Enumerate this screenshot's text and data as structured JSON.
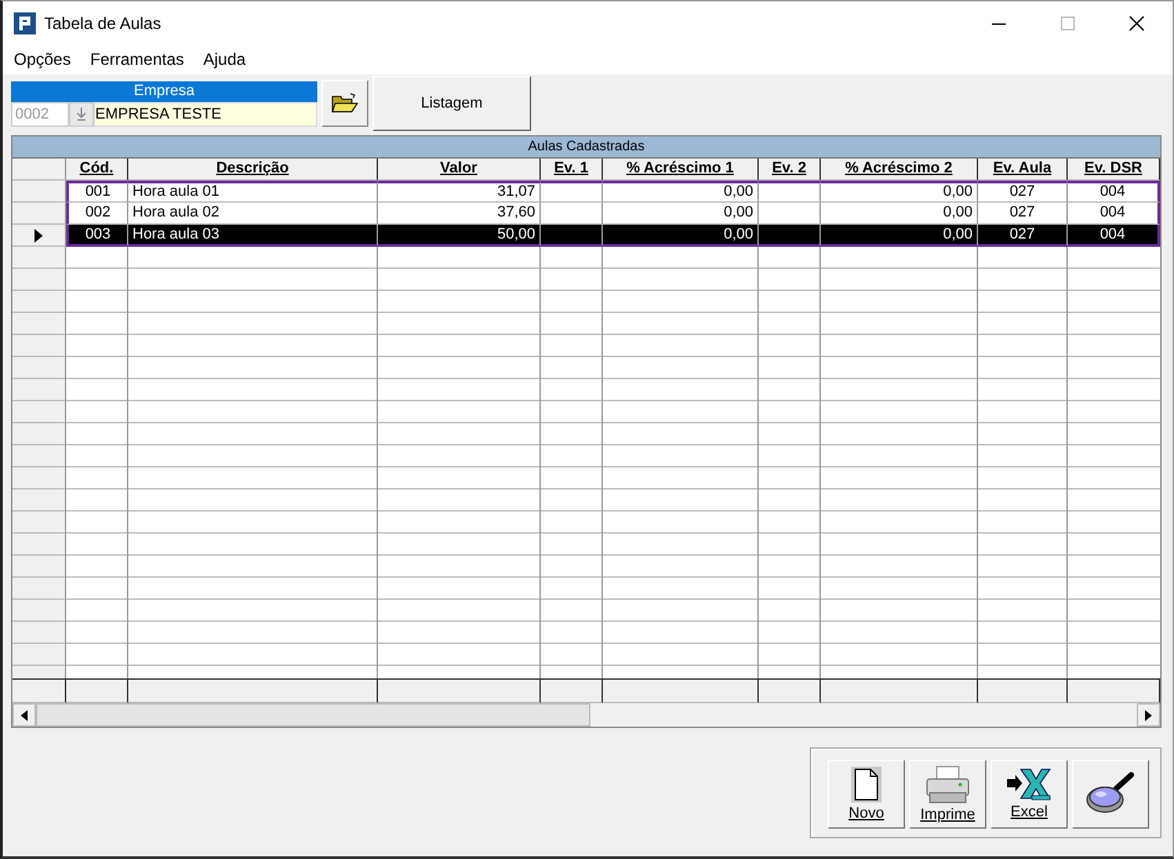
{
  "window": {
    "title": "Tabela de Aulas"
  },
  "menu": [
    "Opções",
    "Ferramentas",
    "Ajuda"
  ],
  "empresa": {
    "label": "Empresa",
    "code": "0002",
    "code_disabled": true,
    "name": "EMPRESA TESTE"
  },
  "listagem_button": "Listagem",
  "grid": {
    "title": "Aulas Cadastradas",
    "columns": [
      "Cód.",
      "Descrição",
      "Valor",
      "Ev. 1",
      "% Acréscimo 1",
      "Ev. 2",
      "% Acréscimo 2",
      "Ev. Aula",
      "Ev. DSR"
    ],
    "rows": [
      {
        "selected": false,
        "cells": [
          "001",
          "Hora aula 01",
          "31,07",
          "",
          "0,00",
          "",
          "0,00",
          "027",
          "004"
        ]
      },
      {
        "selected": false,
        "cells": [
          "002",
          "Hora aula 02",
          "37,60",
          "",
          "0,00",
          "",
          "0,00",
          "027",
          "004"
        ]
      },
      {
        "selected": true,
        "cells": [
          "003",
          "Hora aula 03",
          "50,00",
          "",
          "0,00",
          "",
          "0,00",
          "027",
          "004"
        ]
      }
    ]
  },
  "buttons": [
    {
      "kind": "new",
      "label": "Novo"
    },
    {
      "kind": "print",
      "label": "Imprime"
    },
    {
      "kind": "excel",
      "label": "Excel"
    },
    {
      "kind": "search"
    }
  ]
}
